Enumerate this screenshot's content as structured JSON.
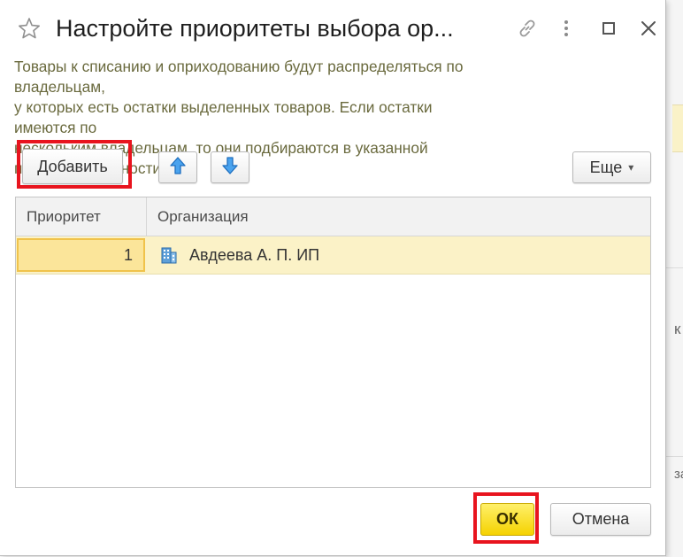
{
  "dialog": {
    "title": "Настройте приоритеты выбора ор...",
    "info_line1": "Товары к списанию и оприходованию будут распределяться по владельцам,",
    "info_line2": "у которых есть остатки выделенных товаров. Если остатки имеются по",
    "info_line3": "нескольким владельцам, то они подбираются в указанной",
    "info_line4": "последовательности."
  },
  "header_icons": {
    "favorite": "star-icon",
    "link": "link-icon",
    "menu": "more-vertical-icon",
    "maximize": "maximize-icon",
    "close": "close-icon"
  },
  "toolbar": {
    "add_label": "Добавить",
    "move_up_icon": "arrow-up-icon",
    "move_down_icon": "arrow-down-icon",
    "more_label": "Еще",
    "more_caret": "▾"
  },
  "table": {
    "columns": [
      "Приоритет",
      "Организация"
    ],
    "rows": [
      {
        "priority": "1",
        "organization": "Авдеева А. П. ИП",
        "icon": "building-icon"
      }
    ]
  },
  "footer": {
    "ok_label": "ОК",
    "cancel_label": "Отмена"
  },
  "background_app": {
    "text_fragment_1": "к",
    "text_fragment_2": "за"
  },
  "colors": {
    "accent_yellow": "#f5d200",
    "highlight_red": "#e8141e",
    "selected_row": "#fbf2c7",
    "info_text": "#6a6a3e",
    "arrow_blue": "#2f86d8"
  }
}
